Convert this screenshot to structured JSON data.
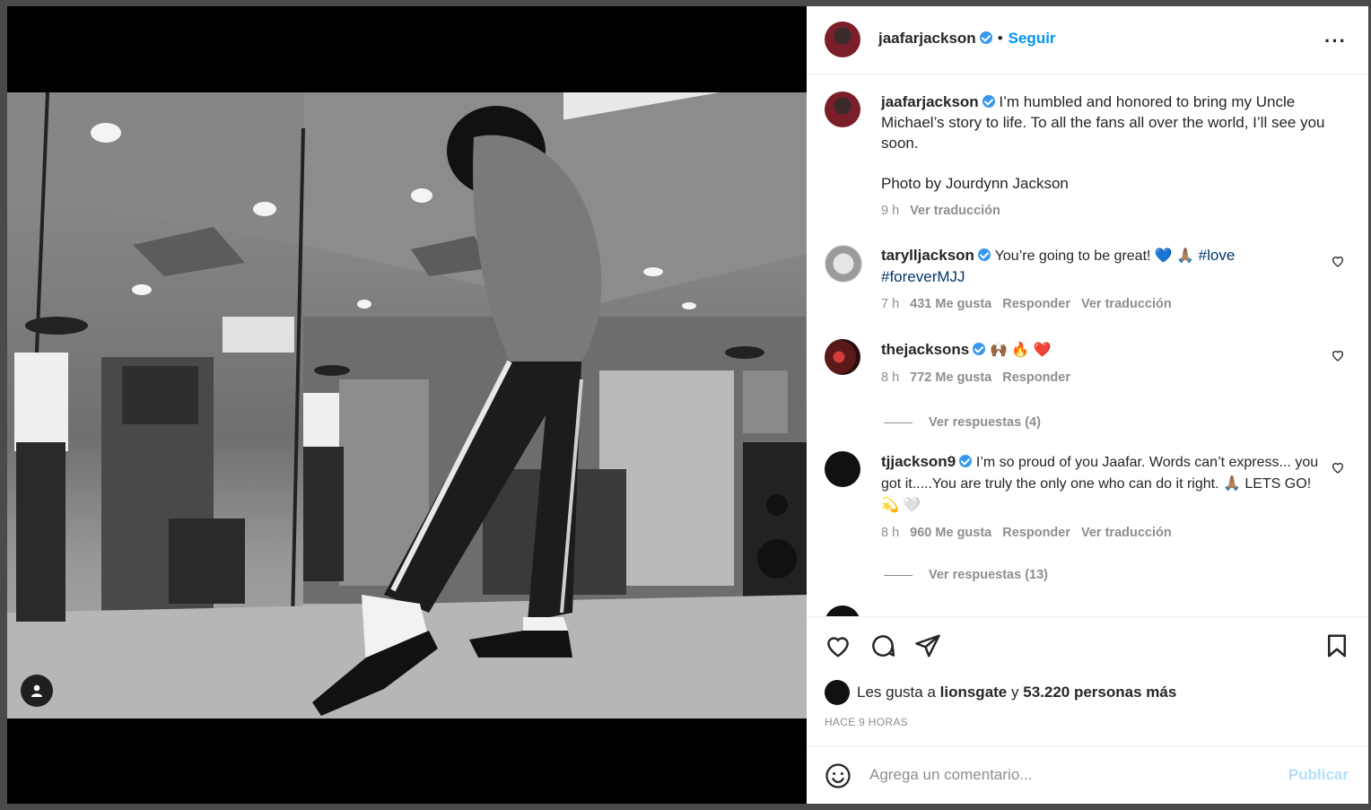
{
  "post": {
    "author": "jaafarjackson",
    "follow_label": "Seguir",
    "dot": "•",
    "more_label": "···",
    "caption": "I’m humbled and honored to bring my Uncle Michael’s story to life. To all the fans all over the world, I’ll see you soon.",
    "caption_credit": "Photo by Jourdynn Jackson",
    "caption_time": "9 h",
    "caption_translate": "Ver traducción"
  },
  "comments": [
    {
      "user": "tarylljackson",
      "text": "You’re going to be great! 💙 🙏🏽 ",
      "tags": [
        "#love",
        "#foreverMJJ"
      ],
      "time": "7 h",
      "likes": "431 Me gusta",
      "reply": "Responder",
      "translate": "Ver traducción"
    },
    {
      "user": "thejacksons",
      "text": "🙌🏾 🔥 ❤️",
      "time": "8 h",
      "likes": "772 Me gusta",
      "reply": "Responder",
      "replies": "Ver respuestas (4)"
    },
    {
      "user": "tjjackson9",
      "text": "I’m so proud of you Jaafar. Words can’t express... you got it.....You are truly the only one who can do it right. 🙏🏽 LETS GO! 💫 🤍",
      "time": "8 h",
      "likes": "960 Me gusta",
      "reply": "Responder",
      "translate": "Ver traducción",
      "replies": "Ver respuestas (13)"
    }
  ],
  "likes": {
    "prefix": "Les gusta a",
    "user": "lionsgate",
    "connector": "y",
    "others": "53.220 personas más"
  },
  "timestamp": "HACE 9 HORAS",
  "composer": {
    "placeholder": "Agrega un comentario...",
    "publish": "Publicar"
  },
  "colors": {
    "link_blue": "#0095f6",
    "verified_blue": "#3897f0",
    "muted": "#8e8e8e",
    "text": "#262626",
    "publish_disabled": "#b2dffc"
  }
}
